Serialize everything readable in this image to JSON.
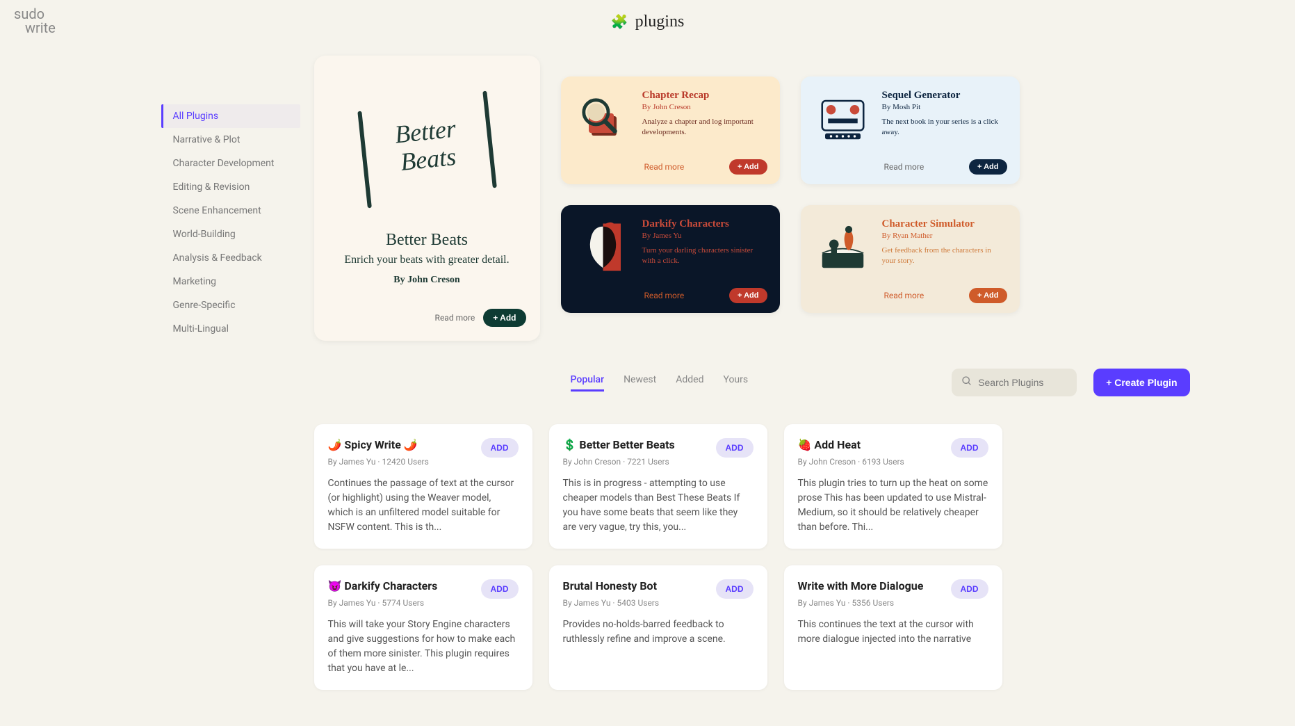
{
  "brand": {
    "line1": "sudo",
    "line2": "write"
  },
  "page_title": "plugins",
  "sidebar": {
    "items": [
      {
        "label": "All Plugins",
        "active": true
      },
      {
        "label": "Narrative & Plot"
      },
      {
        "label": "Character Development"
      },
      {
        "label": "Editing & Revision"
      },
      {
        "label": "Scene Enhancement"
      },
      {
        "label": "World-Building"
      },
      {
        "label": "Analysis & Feedback"
      },
      {
        "label": "Marketing"
      },
      {
        "label": "Genre-Specific"
      },
      {
        "label": "Multi-Lingual"
      }
    ]
  },
  "featured_large": {
    "art_text": "Better\nBeats",
    "title": "Better Beats",
    "desc": "Enrich your beats with greater detail.",
    "author": "By John Creson",
    "read_more": "Read more",
    "add": "+ Add"
  },
  "featured_small": [
    {
      "title": "Chapter Recap",
      "author": "By John Creson",
      "desc": "Analyze a chapter and log important developments.",
      "read_more": "Read more",
      "add": "+ Add",
      "theme": "peach"
    },
    {
      "title": "Sequel Generator",
      "author": "By Mosh Pit",
      "desc": "The next book in your series is a click away.",
      "read_more": "Read more",
      "add": "+ Add",
      "theme": "blue"
    },
    {
      "title": "Darkify Characters",
      "author": "By James Yu",
      "desc": "Turn your darling characters sinister with a click.",
      "read_more": "Read more",
      "add": "+ Add",
      "theme": "dark"
    },
    {
      "title": "Character Simulator",
      "author": "By Ryan Mather",
      "desc": "Get feedback from the characters in your story.",
      "read_more": "Read more",
      "add": "+ Add",
      "theme": "cream"
    }
  ],
  "tabs": [
    {
      "label": "Popular",
      "active": true
    },
    {
      "label": "Newest"
    },
    {
      "label": "Added"
    },
    {
      "label": "Yours"
    }
  ],
  "search": {
    "placeholder": "Search Plugins"
  },
  "create_button": "+ Create Plugin",
  "add_label": "ADD",
  "plugins": [
    {
      "emoji": "🌶️",
      "title": "Spicy Write 🌶️",
      "author": "James Yu",
      "users": "12420",
      "desc": "Continues the passage of text at the cursor (or highlight) using the Weaver model, which is an unfiltered model suitable for NSFW content. This is th..."
    },
    {
      "emoji": "💲",
      "title": "Better Better Beats",
      "author": "John Creson",
      "users": "7221",
      "desc": "This is in progress - attempting to use cheaper models than Best These Beats If you have some beats that seem like they are very vague, try this, you..."
    },
    {
      "emoji": "🍓",
      "title": "Add Heat",
      "author": "John Creson",
      "users": "6193",
      "desc": "This plugin tries to turn up the heat on some prose This has been updated to use Mistral-Medium, so it should be relatively cheaper than before. Thi..."
    },
    {
      "emoji": "😈",
      "title": "Darkify Characters",
      "author": "James Yu",
      "users": "5774",
      "desc": "This will take your Story Engine characters and give suggestions for how to make each of them more sinister. This plugin requires that you have at le..."
    },
    {
      "emoji": "",
      "title": "Brutal Honesty Bot",
      "author": "James Yu",
      "users": "5403",
      "desc": "Provides no-holds-barred feedback to ruthlessly refine and improve a scene."
    },
    {
      "emoji": "",
      "title": "Write with More Dialogue",
      "author": "James Yu",
      "users": "5356",
      "desc": "This continues the text at the cursor with more dialogue injected into the narrative"
    }
  ]
}
